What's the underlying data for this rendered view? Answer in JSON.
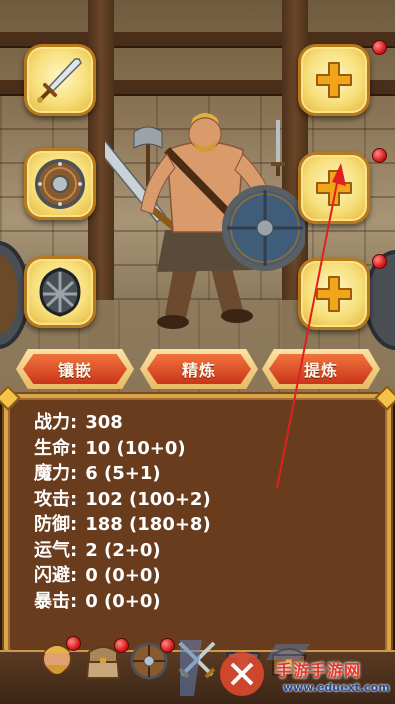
{
  "left_slots": [
    {
      "name": "weapon-slot",
      "icon": "sword-icon"
    },
    {
      "name": "shield-slot",
      "icon": "round-shield-icon"
    },
    {
      "name": "armor-slot",
      "icon": "helmet-icon"
    }
  ],
  "right_slots": [
    {
      "name": "empty-slot-1",
      "icon": "plus-icon"
    },
    {
      "name": "empty-slot-2",
      "icon": "plus-icon"
    },
    {
      "name": "empty-slot-3",
      "icon": "plus-icon"
    }
  ],
  "actions": {
    "inlay": "镶嵌",
    "refine": "精炼",
    "extract": "提炼"
  },
  "stats": [
    {
      "label": "战力:",
      "value": "308"
    },
    {
      "label": "生命:",
      "value": "10 (10+0)"
    },
    {
      "label": "魔力:",
      "value": "6 (5+1)"
    },
    {
      "label": "攻击:",
      "value": "102 (100+2)"
    },
    {
      "label": "防御:",
      "value": "188 (180+8)"
    },
    {
      "label": "运气:",
      "value": "2 (2+0)"
    },
    {
      "label": "闪避:",
      "value": "0 (0+0)"
    },
    {
      "label": "暴击:",
      "value": "0 (0+0)"
    }
  ],
  "bottom_tabs": [
    {
      "name": "tab-hero",
      "icon": "barbarian-portrait-icon"
    },
    {
      "name": "tab-bag",
      "icon": "satchel-icon"
    },
    {
      "name": "tab-equipment",
      "icon": "shield-icon"
    },
    {
      "name": "tab-battle",
      "icon": "crossed-swords-icon"
    },
    {
      "name": "tab-forge",
      "icon": "anvil-icon"
    },
    {
      "name": "tab-shop",
      "icon": "chest-icon"
    }
  ],
  "watermark": {
    "title": "手游手游网",
    "url": "www.eduext.com"
  },
  "colors": {
    "panel_bg": "#6a3c1e",
    "panel_border": "#d9a54a",
    "slot_gold": "#f7df7a",
    "button_red": "#d9441f",
    "badge_red": "#d81c1c",
    "annotation_arrow": "#e02020"
  }
}
